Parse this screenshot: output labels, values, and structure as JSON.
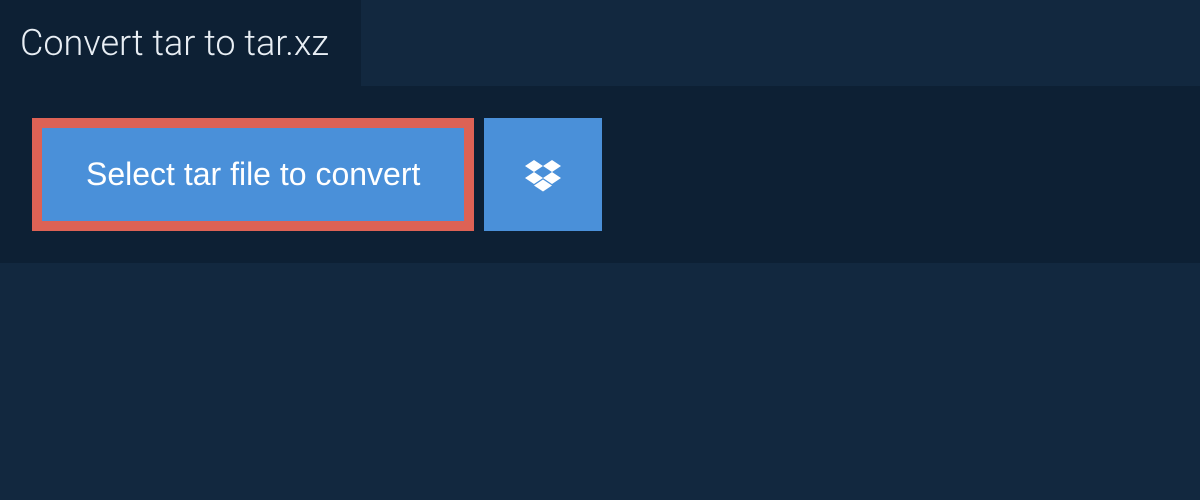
{
  "header": {
    "title": "Convert tar to tar.xz"
  },
  "actions": {
    "select_file_label": "Select tar file to convert",
    "dropbox_icon": "dropbox"
  },
  "colors": {
    "page_bg": "#12283f",
    "panel_bg": "#0d2034",
    "button_bg": "#4a90d9",
    "highlight_border": "#dd6255",
    "text_light": "#e8eef4"
  }
}
